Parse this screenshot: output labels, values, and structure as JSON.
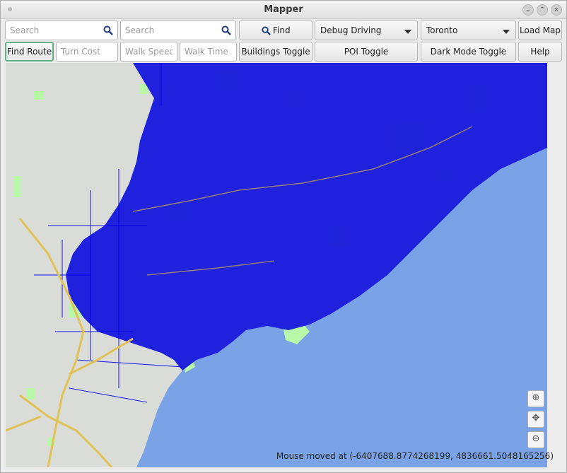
{
  "window": {
    "title": "Mapper",
    "controls": [
      "minimize-icon",
      "maximize-icon",
      "close-icon"
    ]
  },
  "toolbar": {
    "search1_placeholder": "Search",
    "search2_placeholder": "Search",
    "find_label": "Find",
    "debug_select": "Debug Driving",
    "city_select": "Toronto",
    "load_map_label": "Load Map",
    "find_route_label": "Find Route",
    "turn_cost_placeholder": "Turn Cost",
    "walk_speed_placeholder": "Walk Speed",
    "walk_time_placeholder": "Walk Time",
    "buildings_toggle_label": "Buildings Toggle",
    "poi_toggle_label": "POI Toggle",
    "dark_mode_label": "Dark Mode Toggle",
    "help_label": "Help"
  },
  "map": {
    "colors": {
      "land": "#dadcd8",
      "water": "#79a3e6",
      "roads": "#0000ee",
      "parks": "#b7f7a7",
      "highways": "#e0c256"
    },
    "zoom_controls": [
      "zoom-in-icon",
      "pan-icon",
      "zoom-out-icon"
    ],
    "status": "Mouse moved at (-6407688.8774268199, 4836661.5048165256)"
  }
}
